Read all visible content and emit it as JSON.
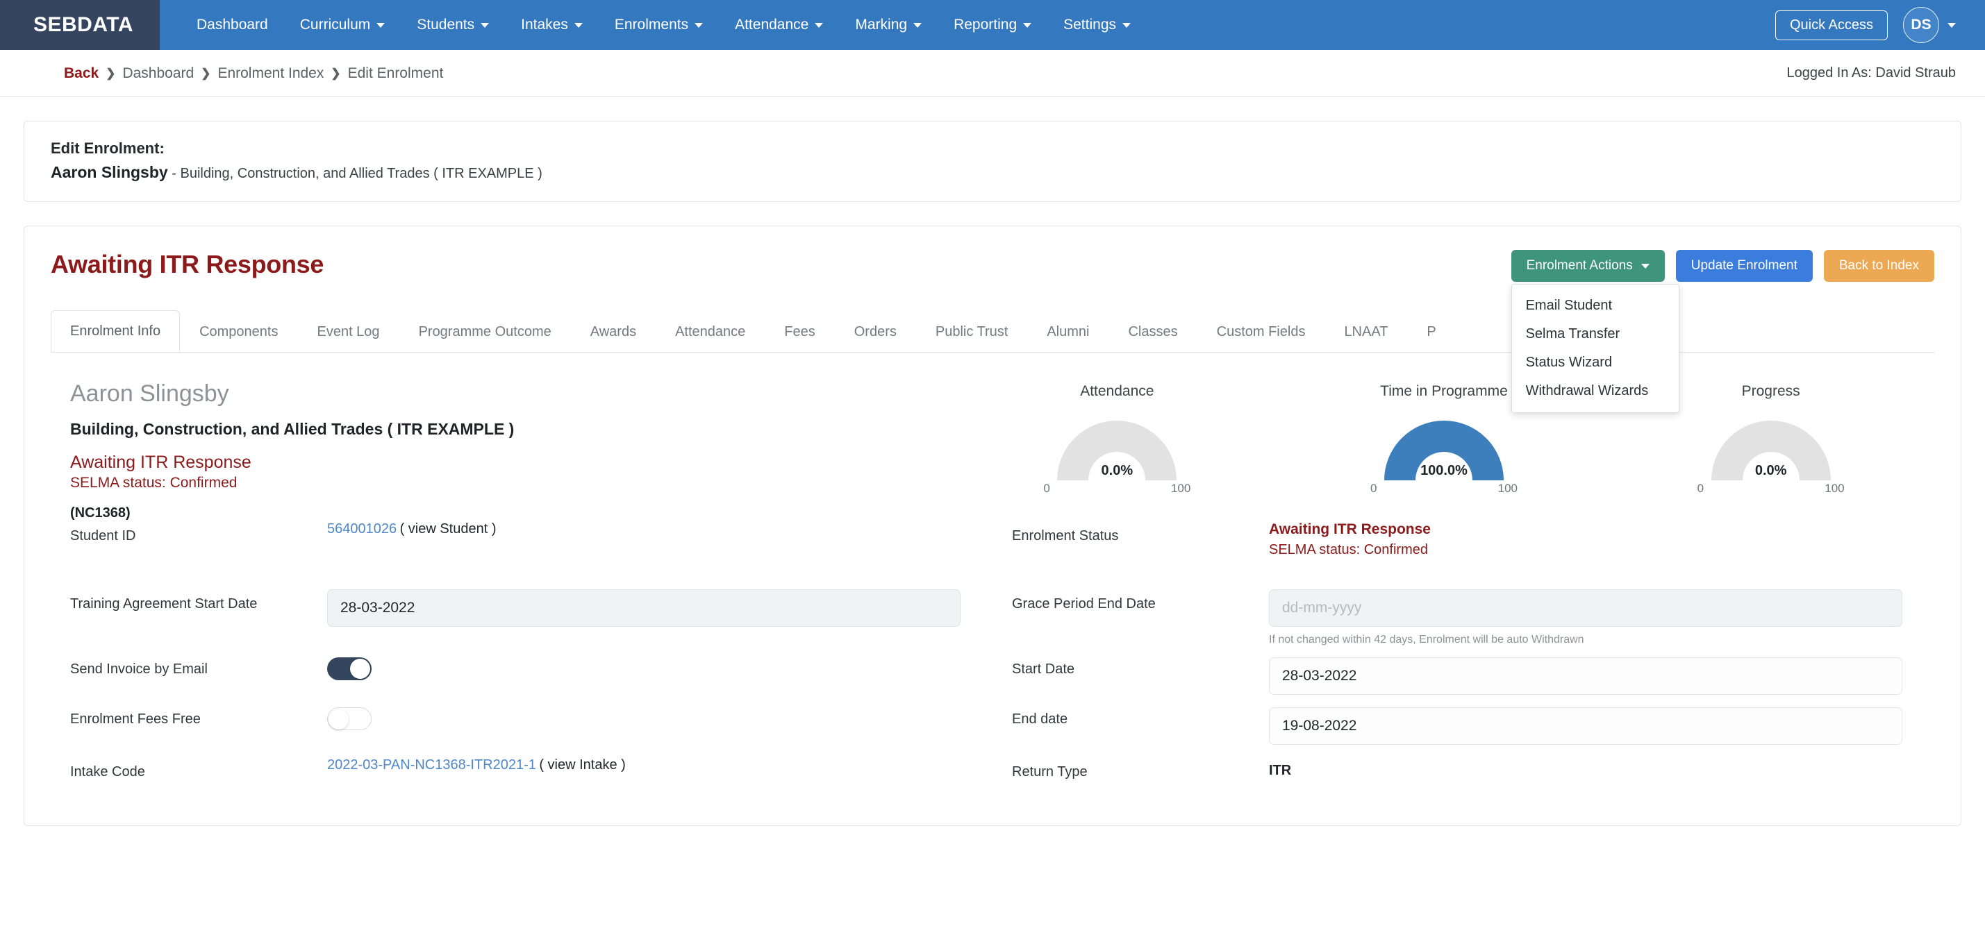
{
  "navbar": {
    "brand": "SEBDATA",
    "items": [
      {
        "label": "Dashboard",
        "caret": false
      },
      {
        "label": "Curriculum",
        "caret": true
      },
      {
        "label": "Students",
        "caret": true
      },
      {
        "label": "Intakes",
        "caret": true
      },
      {
        "label": "Enrolments",
        "caret": true
      },
      {
        "label": "Attendance",
        "caret": true
      },
      {
        "label": "Marking",
        "caret": true
      },
      {
        "label": "Reporting",
        "caret": true
      },
      {
        "label": "Settings",
        "caret": true
      }
    ],
    "quick_access_label": "Quick Access",
    "avatar_initials": "DS",
    "brand_bg": "#35455f",
    "nav_bg": "#3478bf"
  },
  "breadcrumb": {
    "back_label": "Back",
    "separator": "❯",
    "items": [
      "Dashboard",
      "Enrolment Index",
      "Edit Enrolment"
    ],
    "logged_in_as": "Logged In As: David Straub"
  },
  "enrolment_header": {
    "title": "Edit Enrolment:",
    "student_name": "Aaron Slingsby",
    "programme": "- Building, Construction, and Allied Trades ( ITR EXAMPLE )"
  },
  "page": {
    "title": "Awaiting ITR Response",
    "title_color": "#8c1a1a"
  },
  "actions": {
    "enrolment_actions_label": "Enrolment Actions",
    "update_label": "Update Enrolment",
    "back_to_index_label": "Back to Index",
    "dropdown_open": true,
    "dropdown_items": [
      "Email Student",
      "Selma Transfer",
      "Status Wizard",
      "Withdrawal Wizards"
    ]
  },
  "tabs": {
    "active": "Enrolment Info",
    "items": [
      "Enrolment Info",
      "Components",
      "Event Log",
      "Programme Outcome",
      "Awards",
      "Attendance",
      "Fees",
      "Orders",
      "Public Trust",
      "Alumni",
      "Classes",
      "Custom Fields",
      "LNAAT",
      "P"
    ]
  },
  "student_summary": {
    "name": "Aaron Slingsby",
    "programme": "Building, Construction, and Allied Trades ( ITR EXAMPLE )",
    "status": "Awaiting ITR Response",
    "selma_status": "SELMA status: Confirmed",
    "code": "(NC1368)"
  },
  "chart_data": [
    {
      "type": "gauge",
      "title": "Attendance",
      "value": 0.0,
      "value_label": "0.0%",
      "min": 0,
      "max": 100,
      "min_label": "0",
      "max_label": "100",
      "fill_color": "#3d7ebc",
      "track_color": "#e2e2e2"
    },
    {
      "type": "gauge",
      "title": "Time in Programme",
      "value": 100.0,
      "value_label": "100.0%",
      "min": 0,
      "max": 100,
      "min_label": "0",
      "max_label": "100",
      "fill_color": "#3d7ebc",
      "track_color": "#e2e2e2"
    },
    {
      "type": "gauge",
      "title": "Progress",
      "value": 0.0,
      "value_label": "0.0%",
      "min": 0,
      "max": 100,
      "min_label": "0",
      "max_label": "100",
      "fill_color": "#3d7ebc",
      "track_color": "#e2e2e2"
    }
  ],
  "form": {
    "student_id": {
      "label": "Student ID",
      "value": "564001026",
      "link_suffix": "( view Student )"
    },
    "enrolment_status": {
      "label": "Enrolment Status",
      "value": "Awaiting ITR Response",
      "sub": "SELMA status: Confirmed"
    },
    "training_agreement_start": {
      "label": "Training Agreement Start Date",
      "value": "28-03-2022",
      "placeholder": "dd-mm-yyyy"
    },
    "grace_period_end": {
      "label": "Grace Period End Date",
      "value": "",
      "placeholder": "dd-mm-yyyy",
      "hint": "If not changed within 42 days, Enrolment will be auto Withdrawn"
    },
    "send_invoice": {
      "label": "Send Invoice by Email",
      "state": "on"
    },
    "start_date": {
      "label": "Start Date",
      "value": "28-03-2022",
      "placeholder": "dd-mm-yyyy"
    },
    "fees_free": {
      "label": "Enrolment Fees Free",
      "state": "off"
    },
    "end_date": {
      "label": "End date",
      "value": "19-08-2022",
      "placeholder": "dd-mm-yyyy"
    },
    "intake_code": {
      "label": "Intake Code",
      "value": "2022-03-PAN-NC1368-ITR2021-1",
      "link_suffix": "( view Intake )"
    },
    "return_type": {
      "label": "Return Type",
      "value": "ITR"
    }
  }
}
